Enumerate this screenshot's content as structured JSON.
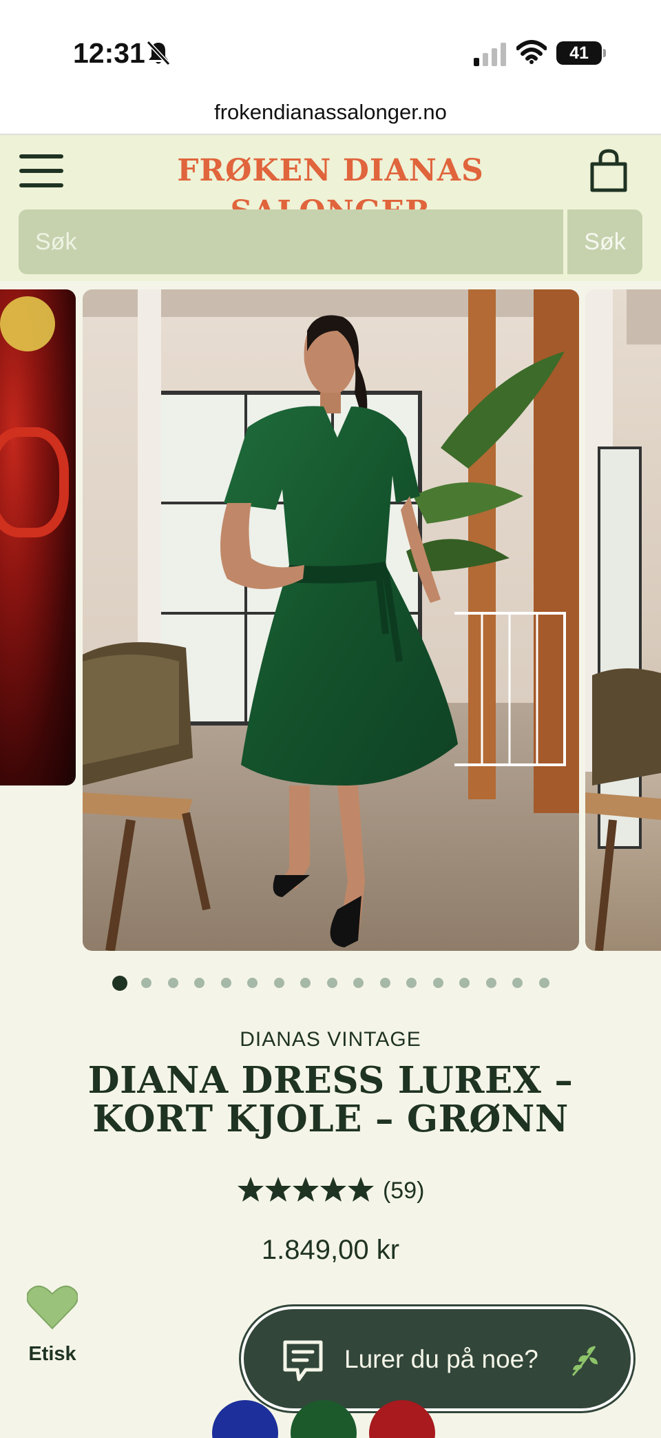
{
  "status_bar": {
    "time": "12:31",
    "battery": "41"
  },
  "browser": {
    "url": "frokendianassalonger.no"
  },
  "header": {
    "logo": "FRØKEN DIANAS SALONGER",
    "search_placeholder": "Søk",
    "search_button": "Søk"
  },
  "carousel": {
    "slide_count": 17,
    "active_index": 0
  },
  "product": {
    "brand": "DIANAS VINTAGE",
    "title": "DIANA DRESS LUREX – KORT KJOLE – GRØNN",
    "rating": {
      "stars": 5,
      "count": "(59)"
    },
    "price": "1.849,00 kr"
  },
  "etisk": {
    "label": "Etisk"
  },
  "chat": {
    "label": "Lurer du på noe?"
  },
  "swatches": [
    {
      "color": "#1c2f9a"
    },
    {
      "color": "#1c5a2c"
    },
    {
      "color": "#a81a1e"
    }
  ],
  "colors": {
    "header_bg": "#eef2d6",
    "logo": "#e0643c",
    "primary_dark": "#1f3323",
    "search_bg": "#c6d2ae",
    "chat_bg": "#32463a",
    "heart": "#9ac27a"
  }
}
